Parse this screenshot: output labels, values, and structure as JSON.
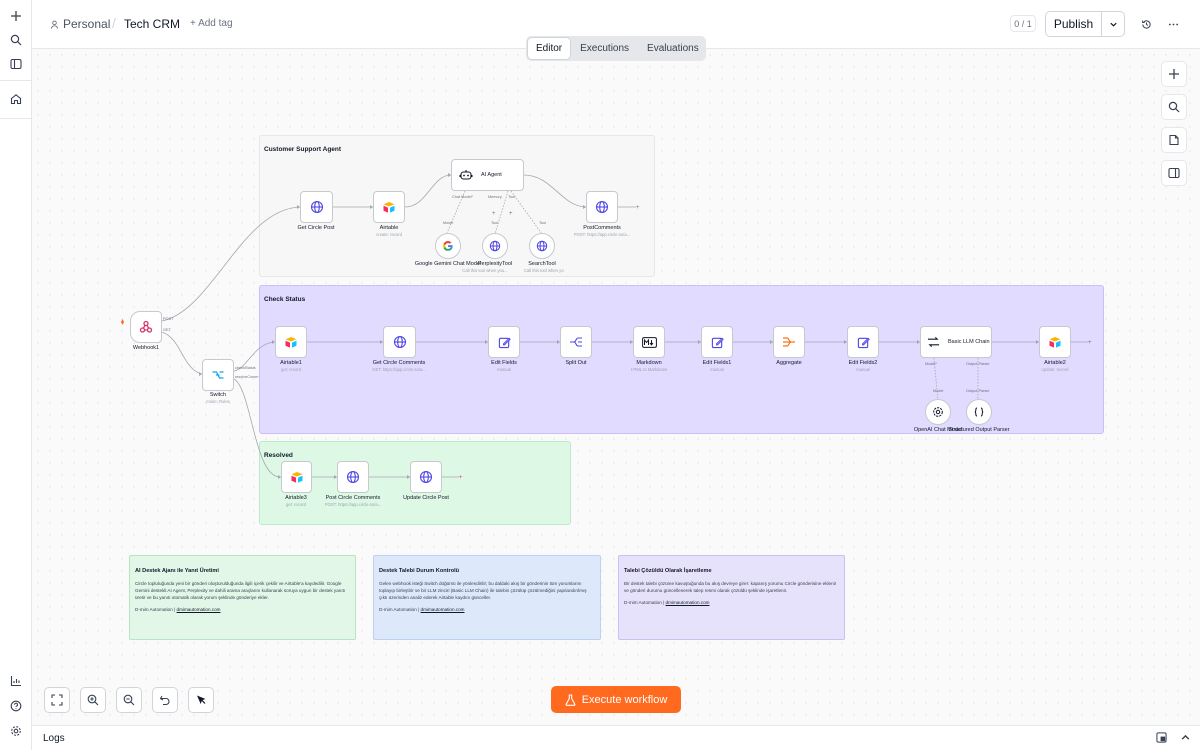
{
  "header": {
    "project": "Personal",
    "separator": "/",
    "workflow_name": "Tech CRM",
    "add_tag": "+ Add tag",
    "version_counter": "0 / 1",
    "publish_label": "Publish"
  },
  "tabs": [
    "Editor",
    "Executions",
    "Evaluations"
  ],
  "groups": [
    {
      "title": "Customer Support Agent"
    },
    {
      "title": "Check Status"
    },
    {
      "title": "Resolved"
    }
  ],
  "nodes": {
    "webhook": {
      "label": "Webhook1",
      "port_post": "POST",
      "port_get": "GET"
    },
    "switch": {
      "label": "Switch",
      "sub": "mode: Rules",
      "port_a": "checkStatus",
      "port_b": "resolveComm"
    },
    "get_circle_post": {
      "label": "Get Circle Post"
    },
    "airtable_create": {
      "label": "Airtable",
      "sub": "create: record"
    },
    "ai_agent": {
      "label": "AI Agent",
      "port_model": "Chat Model*",
      "port_memory": "Memory",
      "port_tool": "Tool"
    },
    "post_comments": {
      "label": "PostComments",
      "sub": "POST: https://app.circle.so/a..."
    },
    "gemini": {
      "label": "Google Gemini Chat Model",
      "port": "Model"
    },
    "perplexity": {
      "label": "PerplexityTool",
      "sub": "Call this tool when you...",
      "port": "Tool"
    },
    "search": {
      "label": "SearchTool",
      "sub": "Call this tool when you...",
      "port": "Tool"
    },
    "airtable1": {
      "label": "Airtable1",
      "sub": "get: record"
    },
    "get_circle_comments": {
      "label": "Get Circle Comments",
      "sub": "GET: https://app.circle.so/a..."
    },
    "edit_fields": {
      "label": "Edit Fields",
      "sub": "manual"
    },
    "split_out": {
      "label": "Split Out"
    },
    "markdown": {
      "label": "Markdown",
      "sub": "HTML to Markdown"
    },
    "edit_fields1": {
      "label": "Edit Fields1",
      "sub": "manual"
    },
    "aggregate": {
      "label": "Aggregate"
    },
    "edit_fields2": {
      "label": "Edit Fields2",
      "sub": "manual"
    },
    "basic_llm": {
      "label": "Basic LLM Chain",
      "port_model": "Model*",
      "port_parser": "Output Parser"
    },
    "airtable2": {
      "label": "Airtable2",
      "sub": "update: record"
    },
    "openai_model": {
      "label": "OpenAI Chat Model",
      "port": "Model"
    },
    "structured_parser": {
      "label": "Structured Output Parser",
      "port": "Output Parser"
    },
    "airtable3": {
      "label": "Airtable3",
      "sub": "get: record"
    },
    "post_circle_comments": {
      "label": "Post Circle Comments",
      "sub": "POST: https://app.circle.so/a..."
    },
    "update_circle_post": {
      "label": "Update Circle Post"
    }
  },
  "notes": [
    {
      "title": "AI Destek Ajanı ile Yanıt Üretimi",
      "body": "Circle topluluğunda yeni bir gönderi oluşturulduğunda ilgili içerik çekilir ve Airtable'a kaydedilir. Google Gemini destekli AI Agent, Perplexity ve dahili arama araçlarını kullanarak soruya uygun bir destek yanıtı üretir ve bu yanıtı otomatik olarak yorum şeklinde gönderiye ekler.",
      "author": "D-mim Automation |",
      "link": "dmimautomation.com",
      "bg": "#e2f7e7",
      "border": "#b7e4c2"
    },
    {
      "title": "Destek Talebi Durum Kontrolü",
      "body": "Gelen webhook isteği Switch düğümü ile yönlendirilir; bu daldaki akış bir gönderinin tüm yorumlarını toplayıp birleştirir ve bir LLM zinciri (Basic LLM Chain) ile talebin çözülüp çözülmediğini yapılandırılmış çıktı üzerinden analiz ederek Airtable kaydını günceller.",
      "author": "D-mim Automation |",
      "link": "dmimautomation.com",
      "bg": "#dde9fb",
      "border": "#bcd2f2"
    },
    {
      "title": "Talebi Çözüldü Olarak İşaretleme",
      "body": "Bir destek talebi çözüme kavuştuğunda bu akış devreye girer: kapanış yorumu Circle gönderisine eklenir ve gönderi durumu güncellenerek talep resmi olarak çözüldü şeklinde işaretlenir.",
      "author": "D-mim Automation |",
      "link": "dmimautomation.com",
      "bg": "#e7e2fb",
      "border": "#cbc1f0"
    }
  ],
  "controls": {
    "execute_label": "Execute workflow",
    "logs_label": "Logs"
  },
  "colors": {
    "accent": "#ff6a1f",
    "group_support_bg": "#f7f7f7",
    "group_status_bg": "#e0dbff",
    "group_resolved_bg": "#def8e6",
    "globe": "#4f46e5",
    "edit": "#4f46e5",
    "airtable_yellow": "#fcb400",
    "airtable_red": "#f82b60",
    "airtable_blue": "#18bfff"
  }
}
